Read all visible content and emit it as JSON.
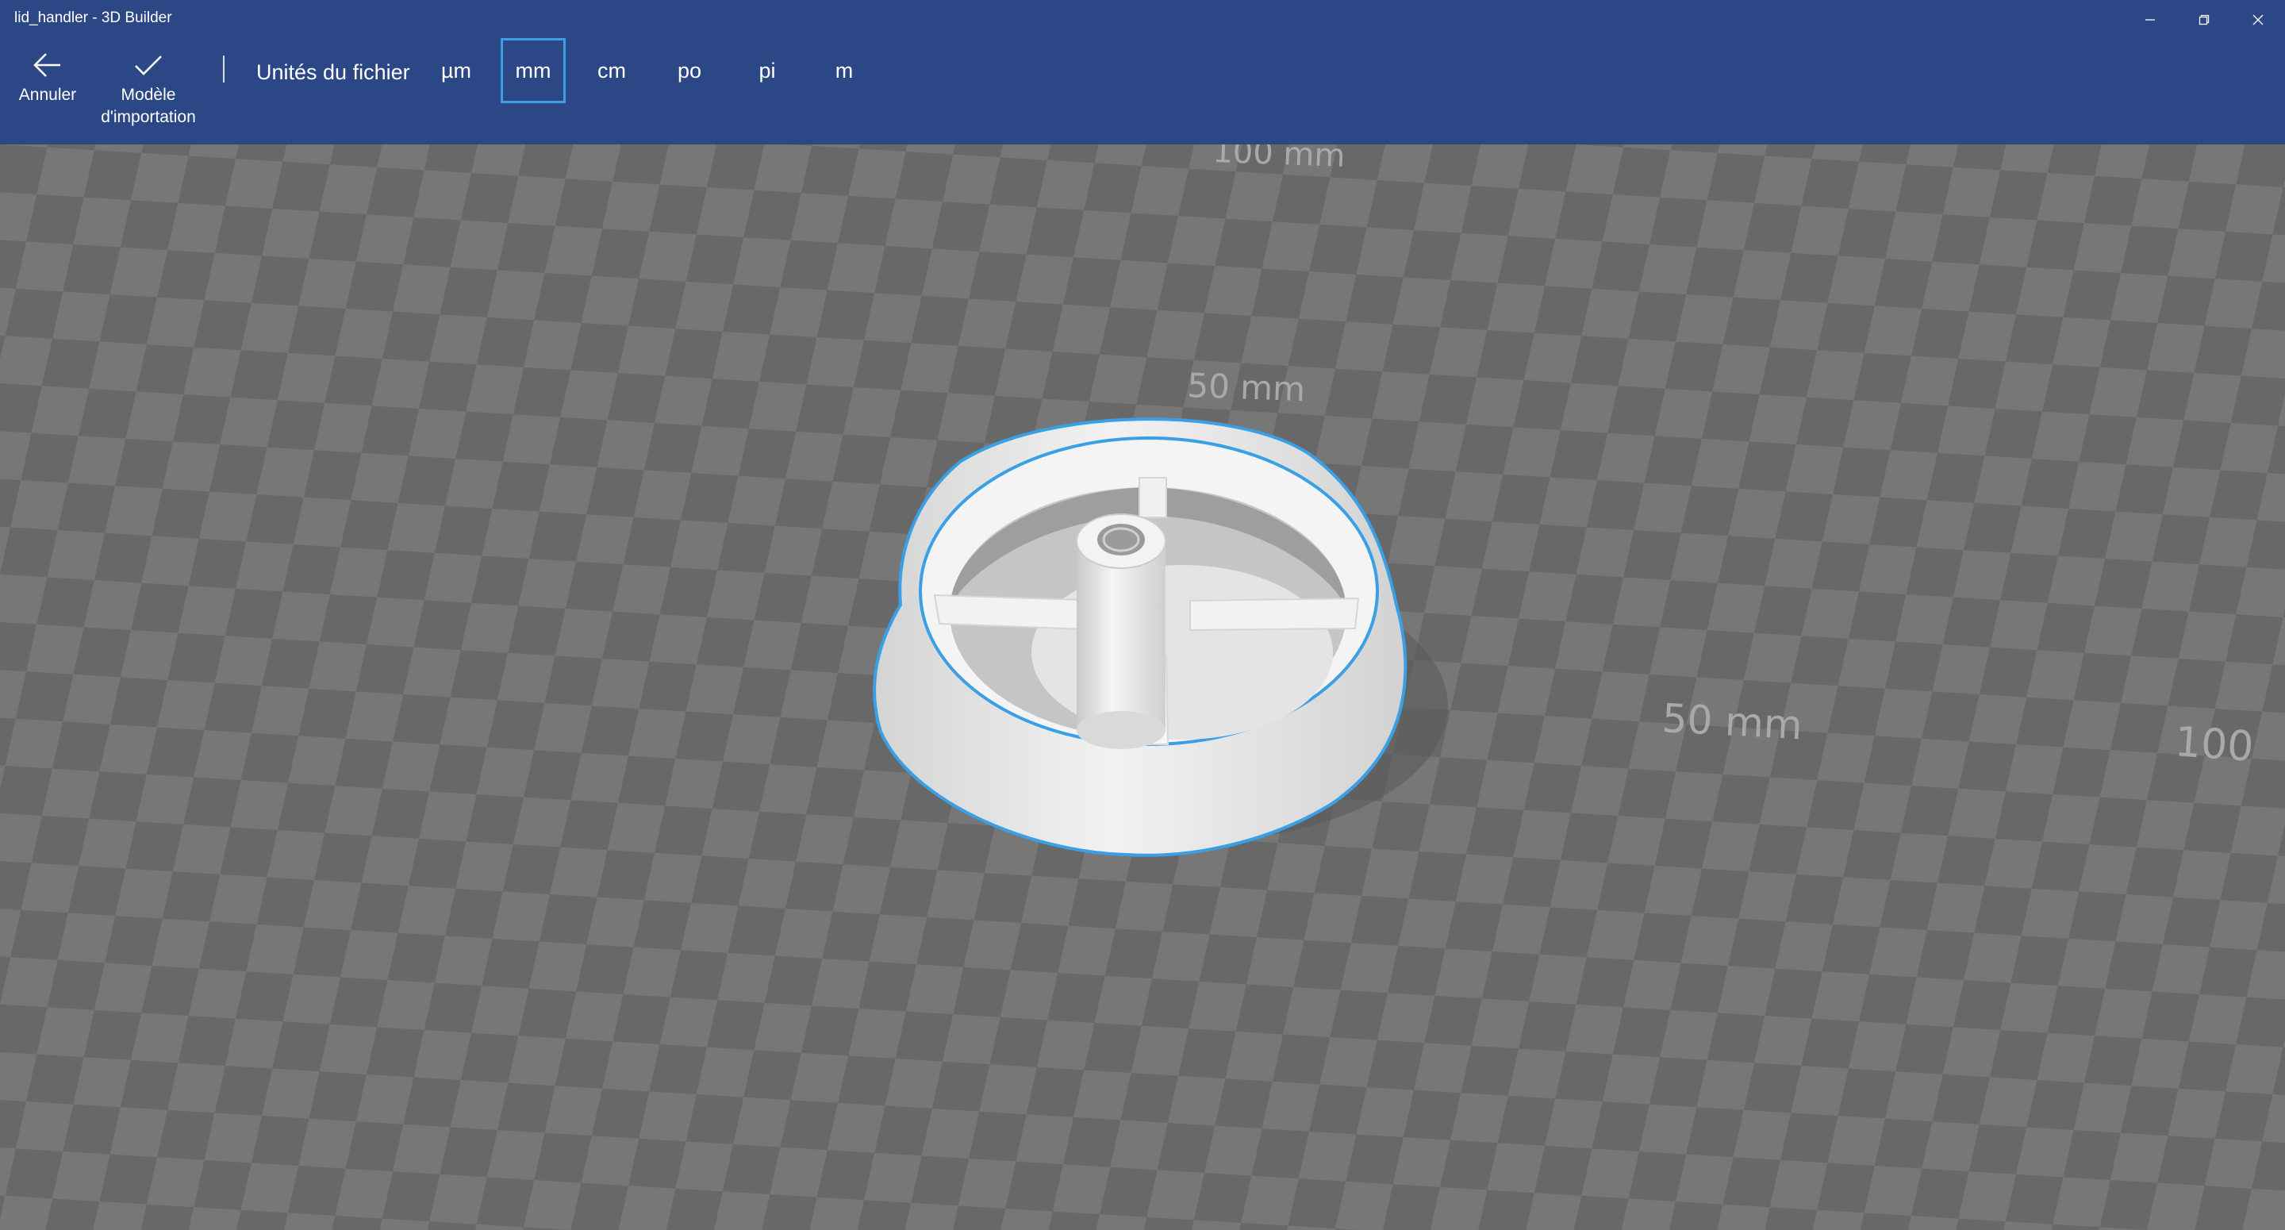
{
  "window": {
    "title": "lid_handler - 3D Builder",
    "controls": [
      "minimize-icon",
      "restore-icon",
      "close-icon"
    ]
  },
  "commands": {
    "back": {
      "label": "Annuler",
      "icon": "back-arrow-icon"
    },
    "import": {
      "label": "Modèle\nd'importation",
      "icon": "checkmark-icon"
    }
  },
  "units": {
    "label": "Unités du fichier",
    "options": [
      "µm",
      "mm",
      "cm",
      "po",
      "pi",
      "m"
    ],
    "selected": "mm"
  },
  "viewport": {
    "grid_labels": [
      "100 mm",
      "50 mm",
      "50 mm",
      "100"
    ]
  },
  "colors": {
    "titlebar": "#2b4785",
    "selection": "#3aa0e6",
    "grid_light": "#777777",
    "grid_dark": "#676767"
  }
}
